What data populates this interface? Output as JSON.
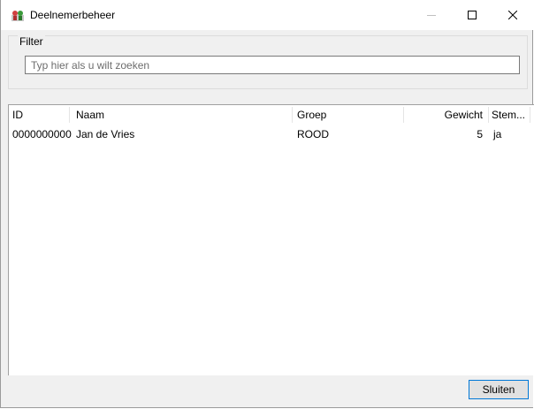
{
  "window": {
    "title": "Deelnemerbeheer"
  },
  "filter": {
    "legend": "Filter",
    "placeholder": "Typ hier als u wilt zoeken"
  },
  "table": {
    "columns": [
      "ID",
      "Naam",
      "Groep",
      "Gewicht",
      "Stem..."
    ],
    "rows": [
      [
        "0000000000",
        "Jan de Vries",
        "ROOD",
        "5",
        "ja"
      ]
    ]
  },
  "buttons": {
    "close_label": "Sluiten"
  },
  "icons": {
    "app": "people-icon",
    "minimize": "minimize-icon",
    "maximize": "maximize-icon",
    "close": "close-icon"
  }
}
